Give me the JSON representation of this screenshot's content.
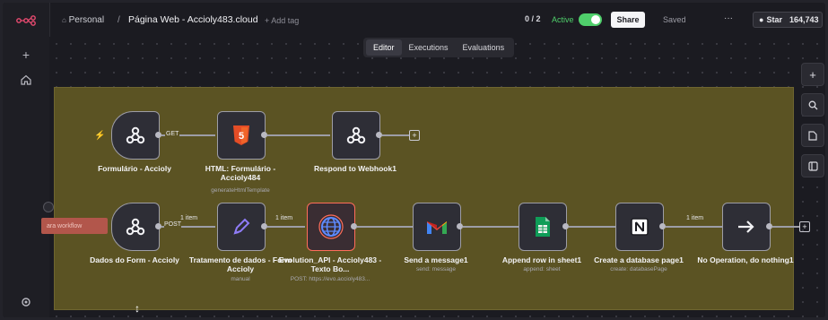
{
  "header": {
    "breadcrumb_owner": "Personal",
    "breadcrumb_separator": "/",
    "workflow_title": "Página Web - Accioly483.cloud",
    "add_tag": "+ Add tag",
    "counter": "0 / 2",
    "active_label": "Active",
    "share_label": "Share",
    "saved_label": "Saved",
    "more_label": "···",
    "star_label": "Star",
    "star_count": "164,743"
  },
  "tabs": [
    {
      "label": "Editor",
      "active": true
    },
    {
      "label": "Executions",
      "active": false
    },
    {
      "label": "Evaluations",
      "active": false
    }
  ],
  "row1": {
    "nodes": [
      {
        "label": "Formulário - Accioly",
        "sub": ""
      },
      {
        "label": "HTML: Formulário - Accioly484",
        "sub": "generateHtmlTemplate"
      },
      {
        "label": "Respond to Webhook1",
        "sub": ""
      }
    ],
    "edge_get": "GET"
  },
  "row2": {
    "nodes": [
      {
        "label": "Dados do Form - Accioly",
        "sub": ""
      },
      {
        "label": "Tratamento de dados - Form Accioly",
        "sub": "manual"
      },
      {
        "label": "Evolution_API - Accioly483 - Texto Bo...",
        "sub": "POST: https://evo.accioly483..."
      },
      {
        "label": "Send a message1",
        "sub": "send: message"
      },
      {
        "label": "Append row in sheet1",
        "sub": "append: sheet"
      },
      {
        "label": "Create a database page1",
        "sub": "create: databasePage"
      },
      {
        "label": "No Operation, do nothing1",
        "sub": ""
      }
    ],
    "edge_post": "POST",
    "edge_item": "1 item",
    "red_tag": "ara workflow"
  },
  "colors": {
    "accent": "#ff6d5a",
    "active_toggle": "#4fcf6b",
    "sticky_note": "#5b5323",
    "canvas": "#1b1b21"
  }
}
